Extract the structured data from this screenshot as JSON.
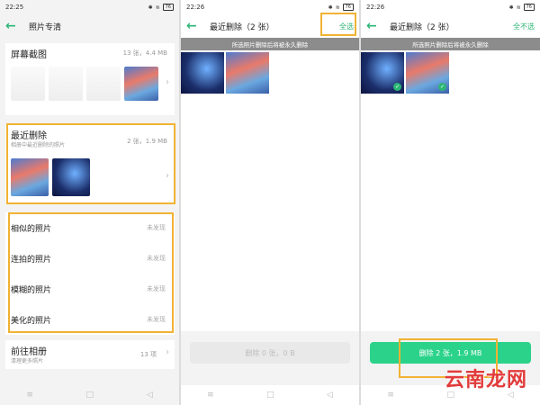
{
  "panel1": {
    "time": "22:25",
    "battery": "76",
    "title": "照片专清",
    "screenshots": {
      "title": "屏幕截图",
      "meta": "13 张，4.4 MB"
    },
    "recent": {
      "title": "最近删除",
      "subtitle": "相册中最近删除的照片",
      "meta": "2 张，1.9 MB"
    },
    "rows": [
      {
        "label": "相似的照片",
        "value": "未发现"
      },
      {
        "label": "连拍的照片",
        "value": "未发现"
      },
      {
        "label": "模糊的照片",
        "value": "未发现"
      },
      {
        "label": "美化的照片",
        "value": "未发现"
      }
    ],
    "album": {
      "title": "前往相册",
      "subtitle": "清理更多照片",
      "meta": "13 项"
    }
  },
  "panel2": {
    "time": "22:26",
    "battery": "76",
    "title": "最近删除（2 张）",
    "select_all": "全选",
    "banner": "所选照片删除后将被永久删除",
    "delete_label": "删除 0 张，0 B"
  },
  "panel3": {
    "time": "22:26",
    "battery": "76",
    "title": "最近删除（2 张）",
    "deselect_all": "全不选",
    "banner": "所选照片删除后将被永久删除",
    "delete_label": "删除 2 张，1.9 MB"
  },
  "watermark": "云南龙网",
  "icons": {
    "back": "back-arrow-icon",
    "chevron": "chevron-right-icon",
    "check": "check-icon",
    "wifi": "wifi-icon",
    "bluetooth": "bluetooth-icon"
  },
  "colors": {
    "accent": "#2bb674",
    "highlight": "#f1b233",
    "delete_active": "#2bd38a"
  }
}
